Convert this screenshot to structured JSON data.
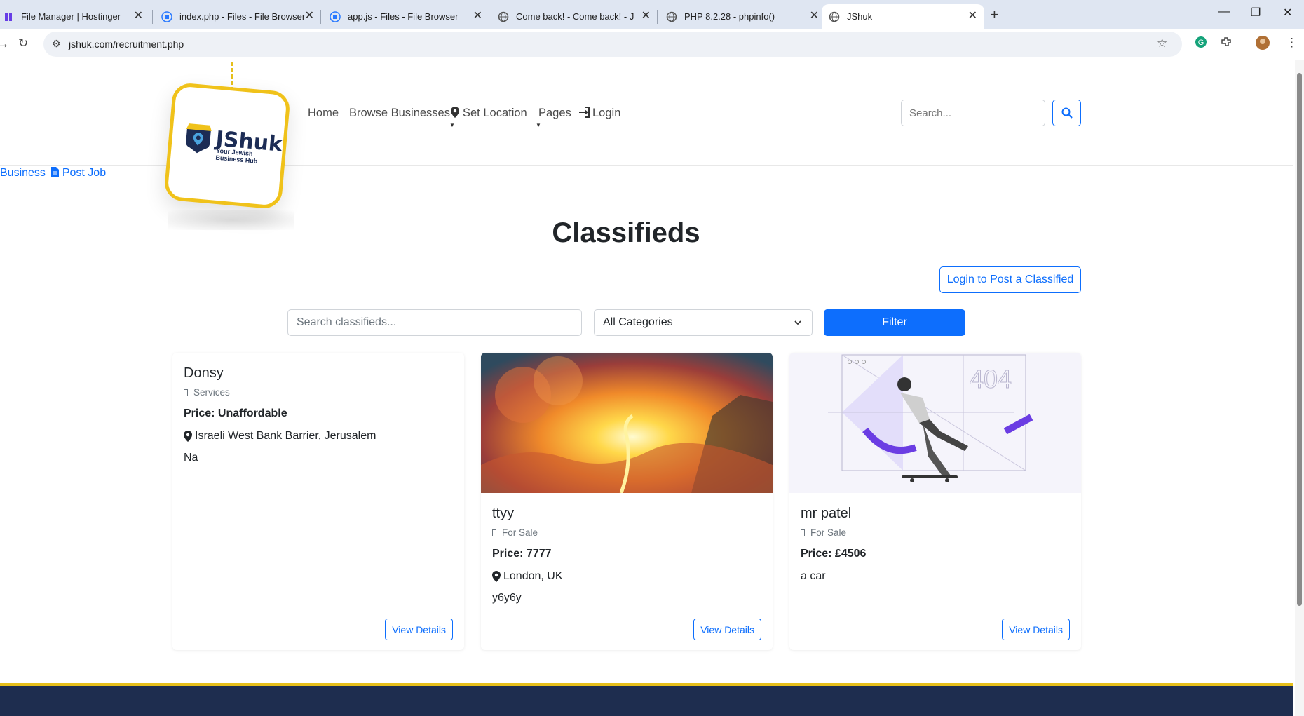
{
  "browser": {
    "tabs": [
      {
        "label": "File Manager | Hostinger",
        "icon": "hostinger-icon",
        "active": false
      },
      {
        "label": "index.php - Files - File Browser",
        "icon": "filebrowser-icon",
        "active": false
      },
      {
        "label": "app.js - Files - File Browser",
        "icon": "filebrowser-icon",
        "active": false
      },
      {
        "label": "Come back! - Come back! - JSh",
        "icon": "globe-icon",
        "active": false
      },
      {
        "label": "PHP 8.2.28 - phpinfo()",
        "icon": "globe-icon",
        "active": false
      },
      {
        "label": "JShuk",
        "icon": "globe-icon",
        "active": true
      }
    ],
    "url": "jshuk.com/recruitment.php"
  },
  "header": {
    "logo_name": "JShuk",
    "logo_tagline_1": "Your Jewish",
    "logo_tagline_2": "Business Hub",
    "nav": {
      "home": "Home",
      "browse": "Browse Businesses",
      "location": "Set Location",
      "pages": "Pages",
      "login": "Login"
    },
    "search_placeholder": "Search..."
  },
  "top_links": {
    "business": "Business",
    "post_job": "Post Job"
  },
  "main": {
    "title": "Classifieds",
    "login_post_label": "Login to Post a Classified",
    "search_placeholder": "Search classifieds...",
    "category_selected": "All Categories",
    "filter_label": "Filter"
  },
  "cards": [
    {
      "title": "Donsy",
      "category": "Services",
      "price": "Price: Unaffordable",
      "location": "Israeli West Bank Barrier, Jerusalem",
      "description": "Na",
      "button": "View Details"
    },
    {
      "title": "ttyy",
      "category": "For Sale",
      "price": "Price: 7777",
      "location": "London, UK",
      "description": "y6y6y",
      "button": "View Details"
    },
    {
      "title": "mr patel",
      "category": "For Sale",
      "price": "Price: £4506",
      "description": "a car",
      "button": "View Details",
      "image_text": "404"
    }
  ],
  "colors": {
    "primary": "#0d6efd",
    "logo_yellow": "#f0c21a",
    "navy": "#1e2d4f"
  }
}
